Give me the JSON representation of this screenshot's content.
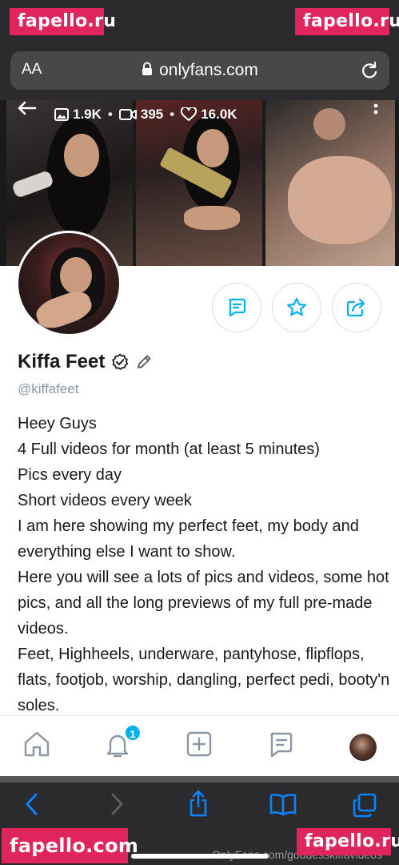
{
  "watermarks": {
    "top_left": "fapello.ru",
    "top_right": "fapello.ru",
    "bottom_left": "fapello.com",
    "bottom_right": "fapello.ru"
  },
  "browser": {
    "text_size_label": "AA",
    "url": "onlyfans.com",
    "lock_icon": "lock-icon",
    "reload_icon": "reload-icon"
  },
  "cover": {
    "stats": {
      "photos": "1.9K",
      "videos": "395",
      "likes": "16.0K",
      "separator": "•"
    }
  },
  "profile": {
    "name": "Kiffa Feet",
    "handle": "@kiffafeet",
    "bio": [
      "Heey Guys",
      "4 Full videos for month (at least 5 minutes)",
      "Pics every day",
      "Short videos every week",
      "I am here showing my perfect feet, my body and everything else I want to show.",
      "Here you will see a lots of pics and videos, some hot pics, and all the long previews of my full pre-made videos.",
      "Feet, Highheels, underware, pantyhose, flipflops, flats, footjob, worship, dangling, perfect pedi, booty'n soles."
    ]
  },
  "nav": {
    "notification_count": "1"
  },
  "footer": {
    "credit": "OnlyFans.com/goddesskiffavideos"
  },
  "colors": {
    "accent": "#00aff0",
    "watermark": "#e0245e",
    "chrome": "#2b2b2d",
    "safari_blue": "#0a84ff"
  }
}
